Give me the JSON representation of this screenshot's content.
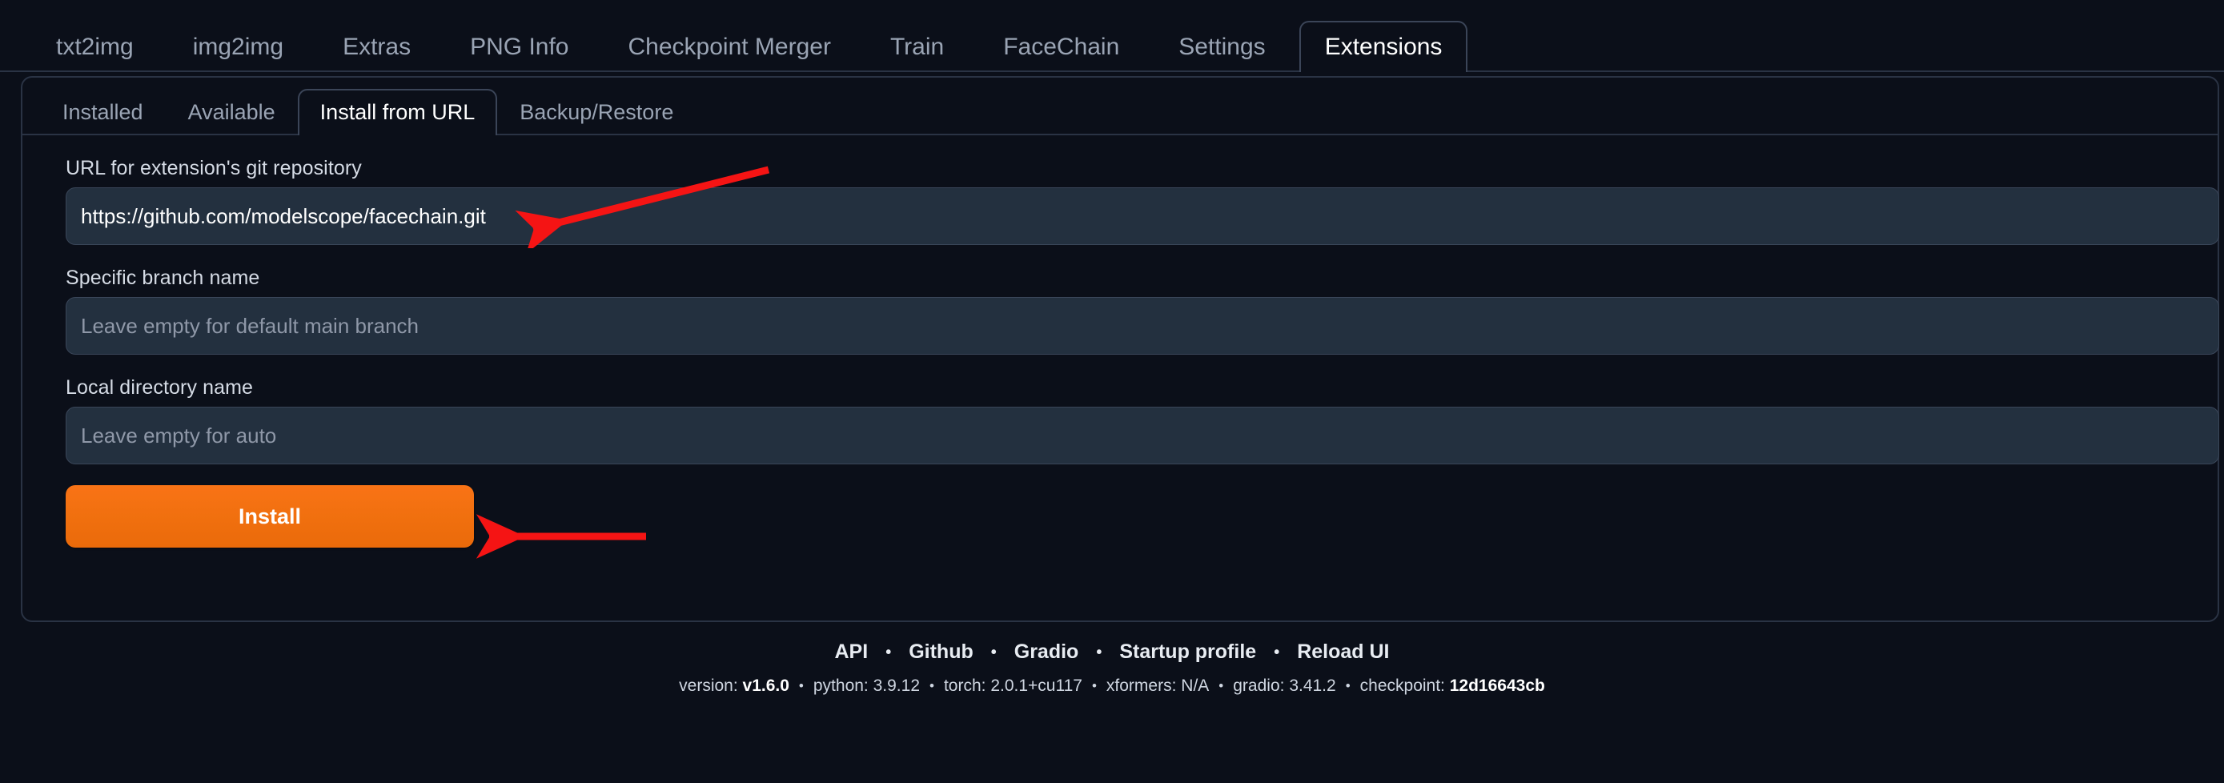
{
  "main_tabs": [
    {
      "label": "txt2img",
      "active": false
    },
    {
      "label": "img2img",
      "active": false
    },
    {
      "label": "Extras",
      "active": false
    },
    {
      "label": "PNG Info",
      "active": false
    },
    {
      "label": "Checkpoint Merger",
      "active": false
    },
    {
      "label": "Train",
      "active": false
    },
    {
      "label": "FaceChain",
      "active": false
    },
    {
      "label": "Settings",
      "active": false
    },
    {
      "label": "Extensions",
      "active": true
    }
  ],
  "sub_tabs": [
    {
      "label": "Installed",
      "active": false
    },
    {
      "label": "Available",
      "active": false
    },
    {
      "label": "Install from URL",
      "active": true
    },
    {
      "label": "Backup/Restore",
      "active": false
    }
  ],
  "form": {
    "url_label": "URL for extension's git repository",
    "url_value": "https://github.com/modelscope/facechain.git",
    "url_placeholder": "",
    "branch_label": "Specific branch name",
    "branch_value": "",
    "branch_placeholder": "Leave empty for default main branch",
    "dir_label": "Local directory name",
    "dir_value": "",
    "dir_placeholder": "Leave empty for auto",
    "install_label": "Install"
  },
  "footer": {
    "links": [
      "API",
      "Github",
      "Gradio",
      "Startup profile",
      "Reload UI"
    ],
    "separator": "•",
    "info": [
      {
        "key": "version:",
        "value": "v1.6.0"
      },
      {
        "key": "python:",
        "value": "3.9.12"
      },
      {
        "key": "torch:",
        "value": "2.0.1+cu117"
      },
      {
        "key": "xformers:",
        "value": "N/A"
      },
      {
        "key": "gradio:",
        "value": "3.41.2"
      },
      {
        "key": "checkpoint:",
        "value": "12d16643cb"
      }
    ]
  },
  "annotations": {
    "arrow_color": "#f51414",
    "url_arrow_name": "red-arrow-icon-url",
    "install_arrow_name": "red-arrow-icon-install"
  },
  "colors": {
    "background": "#0b0f19",
    "panel_border": "#2a3344",
    "input_background": "#23303f",
    "input_border": "#3a4659",
    "accent_orange": "#f97316",
    "text_primary": "#ffffff",
    "text_muted": "#9aa4b4"
  }
}
